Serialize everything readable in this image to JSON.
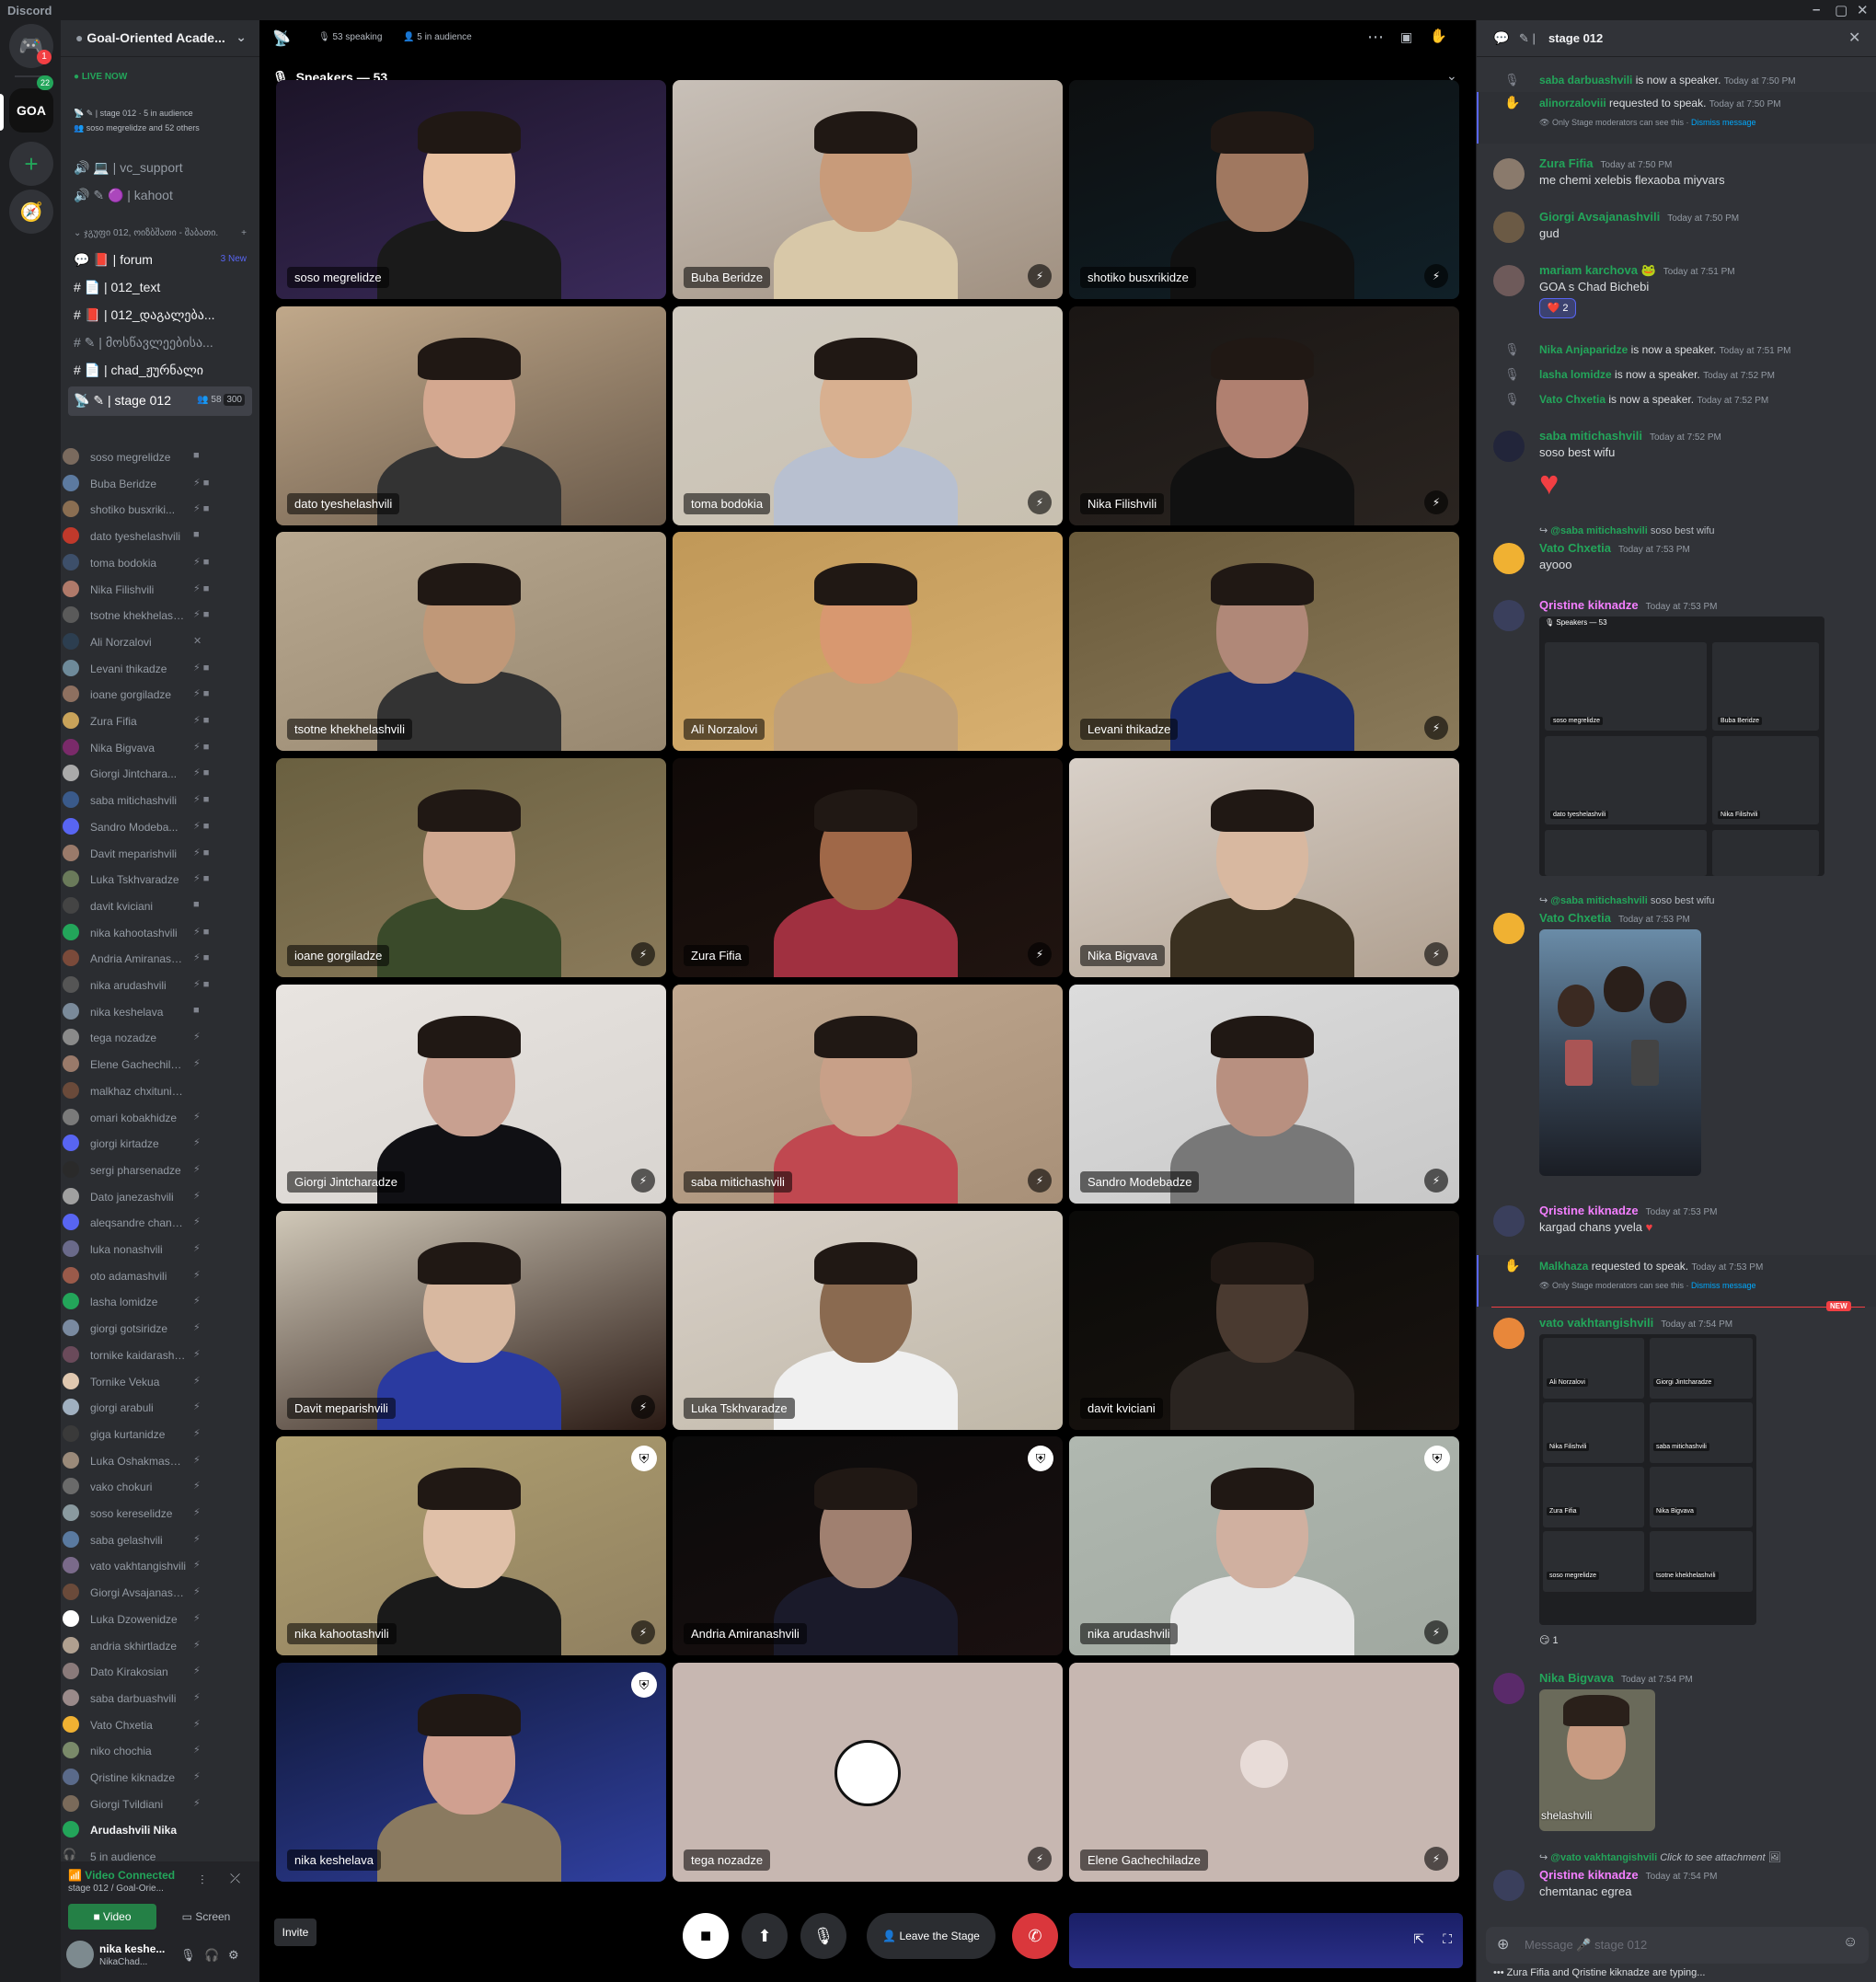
{
  "window": {
    "title": "Discord"
  },
  "guilds": {
    "home_badge": "1",
    "server_label": "GOA",
    "server_badge": "22"
  },
  "server": {
    "name": "Goal-Oriented Acade...",
    "live_label": "LIVE NOW",
    "stage_line": "stage 012 · 5 in audience",
    "stage_users": "soso megrelidze and 52 others"
  },
  "channels": [
    {
      "name": "vc_support",
      "type": "voice"
    },
    {
      "name": "kahoot",
      "type": "voice"
    },
    {
      "name": "ჯგუფი 012, ოიზბშათი - შაბათი.",
      "type": "category"
    },
    {
      "name": "forum",
      "type": "forum",
      "badge": "3 New"
    },
    {
      "name": "012_text",
      "type": "text"
    },
    {
      "name": "012_დაგალება...",
      "type": "text"
    },
    {
      "name": "მოსწავლეებისა...",
      "type": "text"
    },
    {
      "name": "chad_ჟურნალი",
      "type": "text"
    },
    {
      "name": "stage 012",
      "type": "stage",
      "count": "58",
      "limit": "300"
    }
  ],
  "members": [
    "soso megrelidze",
    "Buba Beridze",
    "shotiko busxriki...",
    "dato tyeshelashvili",
    "toma bodokia",
    "Nika Filishvili",
    "tsotne khekhelashvili",
    "Ali Norzalovi",
    "Levani thikadze",
    "ioane gorgiladze",
    "Zura Fifia",
    "Nika Bigvava",
    "Giorgi Jintchara...",
    "saba mitichashvili",
    "Sandro Modeba...",
    "Davit meparishvili",
    "Luka Tskhvaradze",
    "davit kviciani",
    "nika kahootashvili",
    "Andria Amiranashvili",
    "nika arudashvili",
    "nika keshelava",
    "tega nozadze",
    "Elene Gachechiladze",
    "malkhaz chxitunidze",
    "omari kobakhidze",
    "giorgi kirtadze",
    "sergi pharsenadze",
    "Dato janezashvili",
    "aleqsandre chankv...",
    "luka nonashvili",
    "oto adamashvili",
    "lasha lomidze",
    "giorgi gotsiridze",
    "tornike kaidarashvili",
    "Tornike Vekua",
    "giorgi arabuli",
    "giga kurtanidze",
    "Luka Oshakmashvili",
    "vako chokuri",
    "soso kereselidze",
    "saba gelashvili",
    "vato vakhtangishvili",
    "Giorgi Avsajanashvili",
    "Luka Dzowenidze",
    "andria skhirtladze",
    "Dato Kirakosian",
    "saba darbuashvili",
    "Vato Chxetia",
    "niko chochia",
    "Qristine kiknadze",
    "Giorgi Tvildiani",
    "Arudashvili Nika",
    "5 in audience"
  ],
  "voice": {
    "status": "Video Connected",
    "sub": "stage 012 / Goal-Orie...",
    "video_btn": "Video",
    "screen_btn": "Screen"
  },
  "user": {
    "name": "nika keshe...",
    "tag": "NikaChad..."
  },
  "stage": {
    "speaking": "53 speaking",
    "audience": "5 in audience",
    "section": "Speakers — 53",
    "invite": "Invite",
    "leave": "Leave the Stage"
  },
  "tiles": [
    "soso megrelidze",
    "Buba Beridze",
    "shotiko busxrikidze",
    "dato tyeshelashvili",
    "toma bodokia",
    "Nika Filishvili",
    "tsotne khekhelashvili",
    "Ali Norzalovi",
    "Levani thikadze",
    "ioane gorgiladze",
    "Zura Fifia",
    "Nika Bigvava",
    "Giorgi Jintcharadze",
    "saba mitichashvili",
    "Sandro Modebadze",
    "Davit meparishvili",
    "Luka Tskhvaradze",
    "davit kviciani",
    "nika kahootashvili",
    "Andria Amiranashvili",
    "nika arudashvili",
    "nika keshelava",
    "tega nozadze",
    "Elene Gachechiladze"
  ],
  "chat": {
    "channel": "stage 012",
    "input_placeholder": "Message 🎤 stage 012",
    "typing": "Zura Fifia and Qristine kiknadze are typing...",
    "new_label": "NEW",
    "only_mods": "Only Stage moderators can see this ·",
    "dismiss": "Dismiss message",
    "sys1": {
      "user": "saba darbuashvili",
      "text": "is now a speaker.",
      "time": "Today at 7:50 PM"
    },
    "req1": {
      "user": "alinorzaloviii",
      "text": "requested to speak.",
      "time": "Today at 7:50 PM"
    },
    "m1": {
      "user": "Zura Fifia",
      "time": "Today at 7:50 PM",
      "text": "me chemi xelebis flexaoba miyvars"
    },
    "m2": {
      "user": "Giorgi Avsajanashvili",
      "time": "Today at 7:50 PM",
      "text": "gud"
    },
    "m3": {
      "user": "mariam karchova",
      "time": "Today at 7:51 PM",
      "text": "GOA s Chad Bichebi",
      "reaction": "2"
    },
    "sys2": {
      "user": "Nika Anjaparidze",
      "text": "is now a speaker.",
      "time": "Today at 7:51 PM"
    },
    "sys3": {
      "user": "lasha lomidze",
      "text": "is now a speaker.",
      "time": "Today at 7:52 PM"
    },
    "sys4": {
      "user": "Vato Chxetia",
      "text": "is now a speaker.",
      "time": "Today at 7:52 PM"
    },
    "m4": {
      "user": "saba mitichashvili",
      "time": "Today at 7:52 PM",
      "text": "soso best wifu"
    },
    "r5": {
      "mention": "@saba mitichashvili",
      "text": "soso best wifu"
    },
    "m5": {
      "user": "Vato Chxetia",
      "time": "Today at 7:53 PM",
      "text": "ayooo"
    },
    "m6": {
      "user": "Qristine kiknadze",
      "time": "Today at 7:53 PM",
      "shot_header": "Speakers — 53",
      "shot_labels": [
        "soso megrelidze",
        "Buba Beridze",
        "dato tyeshelashvili",
        "Nika Filishvili"
      ]
    },
    "r7": {
      "mention": "@saba mitichashvili",
      "text": "soso best wifu"
    },
    "m7": {
      "user": "Vato Chxetia",
      "time": "Today at 7:53 PM"
    },
    "m8": {
      "user": "Qristine kiknadze",
      "time": "Today at 7:53 PM",
      "text": "kargad chans yvela"
    },
    "req2": {
      "user": "Malkhaza",
      "text": "requested to speak.",
      "time": "Today at 7:53 PM"
    },
    "m9": {
      "user": "vato vakhtangishvili",
      "time": "Today at 7:54 PM",
      "shot_labels": [
        "Ali Norzalovi",
        "Giorgi Jintcharadze",
        "Nika Filishvili",
        "saba mitichashvili",
        "Zura Fifia",
        "Nika Bigvava",
        "soso megrelidze",
        "tsotne khekhelashvili"
      ],
      "reaction": "1"
    },
    "m10": {
      "user": "Nika Bigvava",
      "time": "Today at 7:54 PM",
      "img_label": "shelashvili"
    },
    "r11": {
      "mention": "@vato vakhtangishvili",
      "text": "Click to see attachment"
    },
    "m11": {
      "user": "Qristine kiknadze",
      "time": "Today at 7:54 PM",
      "text": "chemtanac egrea"
    }
  }
}
